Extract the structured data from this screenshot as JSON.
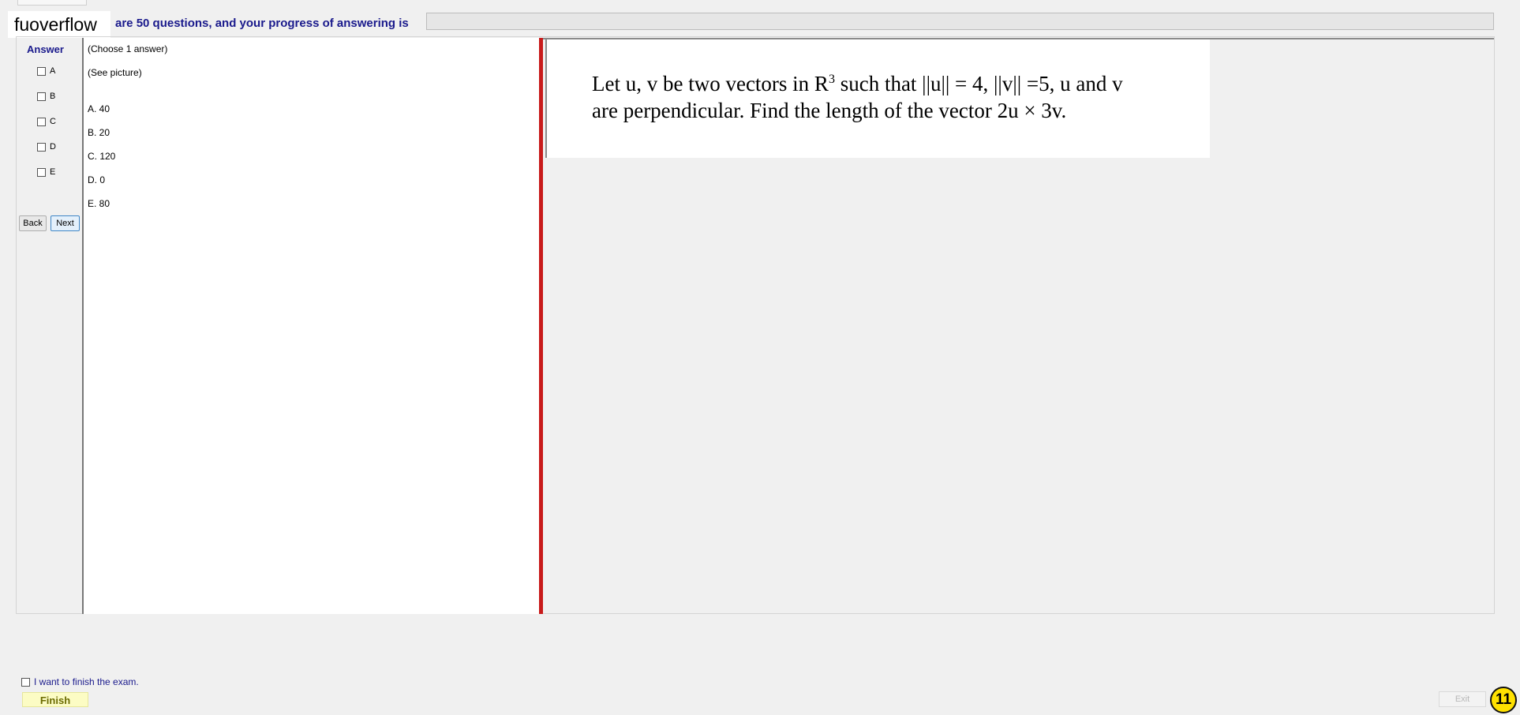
{
  "header": {
    "brand": "fuoverflow",
    "progress_label": "are 50 questions, and your progress of answering is",
    "progress_percent": 0
  },
  "answer_panel": {
    "title": "Answer",
    "options": [
      "A",
      "B",
      "C",
      "D",
      "E"
    ],
    "back_label": "Back",
    "next_label": "Next"
  },
  "question": {
    "instruction": "(Choose 1 answer)",
    "note": "(See picture)",
    "choices": [
      "A. 40",
      "B. 20",
      "C. 120",
      "D. 0",
      "E. 80"
    ]
  },
  "picture": {
    "line1_before": "Let u, v be two vectors in R",
    "line1_sup": "3",
    "line1_after": " such that ||u|| = 4, ||v|| =5, u and v",
    "line2": "are perpendicular. Find the length of the vector 2u × 3v."
  },
  "footer": {
    "finish_check_label": "I want to finish the exam.",
    "finish_label": "Finish",
    "exit_label": "Exit",
    "badge": "11"
  },
  "colors": {
    "accent_blue": "#1a1a8c",
    "divider_red": "#c81b1b",
    "finish_yellow": "#fcfcc4",
    "badge_yellow": "#ffe100"
  }
}
